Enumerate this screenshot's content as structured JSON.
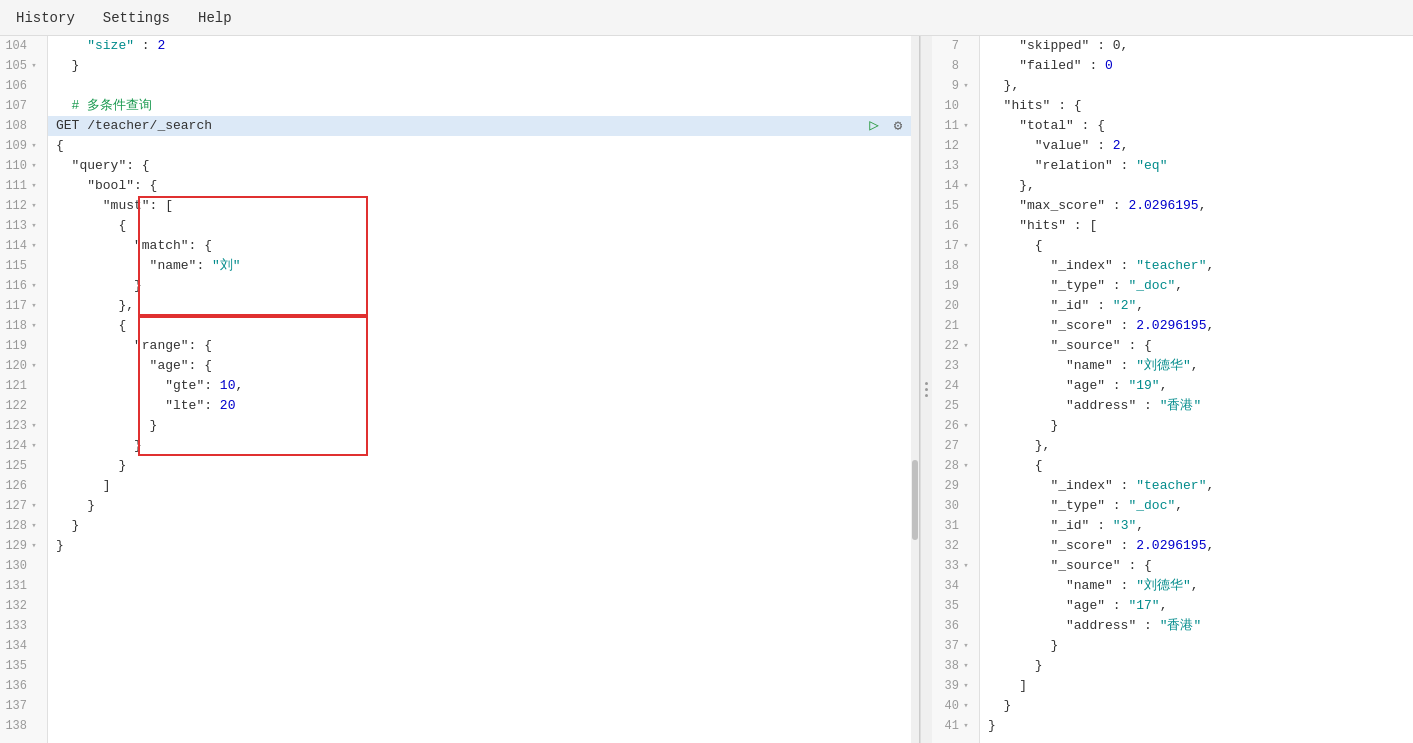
{
  "menu": {
    "items": [
      "History",
      "Settings",
      "Help"
    ]
  },
  "left_panel": {
    "lines": [
      {
        "num": 104,
        "fold": false,
        "content": [
          {
            "text": "    ",
            "class": ""
          },
          {
            "text": "\"size\"",
            "class": "c-teal"
          },
          {
            "text": " : ",
            "class": "c-dark"
          },
          {
            "text": "2",
            "class": "c-blue"
          }
        ]
      },
      {
        "num": 105,
        "fold": true,
        "content": [
          {
            "text": "  }",
            "class": "c-dark"
          }
        ]
      },
      {
        "num": 106,
        "fold": false,
        "content": []
      },
      {
        "num": 107,
        "fold": false,
        "content": [
          {
            "text": "  # 多条件查询",
            "class": "c-green"
          }
        ]
      },
      {
        "num": 108,
        "fold": false,
        "content": [
          {
            "text": "GET /teacher/_search",
            "class": "c-dark"
          }
        ],
        "highlighted": true,
        "toolbar": true
      },
      {
        "num": 109,
        "fold": true,
        "content": [
          {
            "text": "{",
            "class": "c-dark"
          }
        ]
      },
      {
        "num": 110,
        "fold": true,
        "content": [
          {
            "text": "  \"query\": {",
            "class": "c-dark"
          }
        ]
      },
      {
        "num": 111,
        "fold": true,
        "content": [
          {
            "text": "    \"bool\": {",
            "class": "c-dark"
          }
        ]
      },
      {
        "num": 112,
        "fold": true,
        "content": [
          {
            "text": "      \"must\": [",
            "class": "c-dark"
          }
        ]
      },
      {
        "num": 113,
        "fold": true,
        "content": [
          {
            "text": "        {",
            "class": "c-dark"
          }
        ]
      },
      {
        "num": 114,
        "fold": true,
        "content": [
          {
            "text": "          \"match\": {",
            "class": "c-dark"
          }
        ]
      },
      {
        "num": 115,
        "fold": false,
        "content": [
          {
            "text": "            \"name\": ",
            "class": "c-dark"
          },
          {
            "text": "\"刘\"",
            "class": "c-teal"
          }
        ]
      },
      {
        "num": 116,
        "fold": true,
        "content": [
          {
            "text": "          }",
            "class": "c-dark"
          }
        ]
      },
      {
        "num": 117,
        "fold": true,
        "content": [
          {
            "text": "        },",
            "class": "c-dark"
          }
        ]
      },
      {
        "num": 118,
        "fold": true,
        "content": [
          {
            "text": "        {",
            "class": "c-dark"
          }
        ]
      },
      {
        "num": 119,
        "fold": false,
        "content": [
          {
            "text": "          \"range\": {",
            "class": "c-dark"
          }
        ]
      },
      {
        "num": 120,
        "fold": true,
        "content": [
          {
            "text": "            \"age\": {",
            "class": "c-dark"
          }
        ]
      },
      {
        "num": 121,
        "fold": false,
        "content": [
          {
            "text": "              \"gte\": ",
            "class": "c-dark"
          },
          {
            "text": "10",
            "class": "c-blue"
          },
          {
            "text": ",",
            "class": "c-dark"
          }
        ]
      },
      {
        "num": 122,
        "fold": false,
        "content": [
          {
            "text": "              \"lte\": ",
            "class": "c-dark"
          },
          {
            "text": "20",
            "class": "c-blue"
          }
        ]
      },
      {
        "num": 123,
        "fold": true,
        "content": [
          {
            "text": "            }",
            "class": "c-dark"
          }
        ]
      },
      {
        "num": 124,
        "fold": true,
        "content": [
          {
            "text": "          }",
            "class": "c-dark"
          }
        ]
      },
      {
        "num": 125,
        "fold": false,
        "content": [
          {
            "text": "        }",
            "class": "c-dark"
          }
        ]
      },
      {
        "num": 126,
        "fold": false,
        "content": [
          {
            "text": "      ]",
            "class": "c-dark"
          }
        ]
      },
      {
        "num": 127,
        "fold": true,
        "content": [
          {
            "text": "    }",
            "class": "c-dark"
          }
        ]
      },
      {
        "num": 128,
        "fold": true,
        "content": [
          {
            "text": "  }",
            "class": "c-dark"
          }
        ]
      },
      {
        "num": 129,
        "fold": true,
        "content": [
          {
            "text": "}",
            "class": "c-dark"
          }
        ]
      },
      {
        "num": 130,
        "fold": false,
        "content": []
      },
      {
        "num": 131,
        "fold": false,
        "content": []
      },
      {
        "num": 132,
        "fold": false,
        "content": []
      },
      {
        "num": 133,
        "fold": false,
        "content": []
      },
      {
        "num": 134,
        "fold": false,
        "content": []
      },
      {
        "num": 135,
        "fold": false,
        "content": []
      },
      {
        "num": 136,
        "fold": false,
        "content": []
      },
      {
        "num": 137,
        "fold": false,
        "content": []
      },
      {
        "num": 138,
        "fold": false,
        "content": []
      }
    ]
  },
  "right_panel": {
    "lines": [
      {
        "num": 7,
        "fold": false,
        "content": [
          {
            "text": "    \"skipped\" : 0,",
            "class": "c-dark"
          }
        ]
      },
      {
        "num": 8,
        "fold": false,
        "content": [
          {
            "text": "    \"failed\" : ",
            "class": "c-dark"
          },
          {
            "text": "0",
            "class": "c-blue"
          }
        ]
      },
      {
        "num": 9,
        "fold": true,
        "content": [
          {
            "text": "  },",
            "class": "c-dark"
          }
        ]
      },
      {
        "num": 10,
        "fold": false,
        "content": [
          {
            "text": "  \"hits\" : {",
            "class": "c-dark"
          }
        ]
      },
      {
        "num": 11,
        "fold": true,
        "content": [
          {
            "text": "    \"total\" : {",
            "class": "c-dark"
          }
        ]
      },
      {
        "num": 12,
        "fold": false,
        "content": [
          {
            "text": "      \"value\" : ",
            "class": "c-dark"
          },
          {
            "text": "2",
            "class": "c-blue"
          },
          {
            "text": ",",
            "class": "c-dark"
          }
        ]
      },
      {
        "num": 13,
        "fold": false,
        "content": [
          {
            "text": "      \"relation\" : ",
            "class": "c-dark"
          },
          {
            "text": "\"eq\"",
            "class": "c-teal"
          }
        ]
      },
      {
        "num": 14,
        "fold": true,
        "content": [
          {
            "text": "    },",
            "class": "c-dark"
          }
        ]
      },
      {
        "num": 15,
        "fold": false,
        "content": [
          {
            "text": "    \"max_score\" : ",
            "class": "c-dark"
          },
          {
            "text": "2.0296195",
            "class": "c-blue"
          },
          {
            "text": ",",
            "class": "c-dark"
          }
        ]
      },
      {
        "num": 16,
        "fold": false,
        "content": [
          {
            "text": "    \"hits\" : [",
            "class": "c-dark"
          }
        ]
      },
      {
        "num": 17,
        "fold": true,
        "content": [
          {
            "text": "      {",
            "class": "c-dark"
          }
        ]
      },
      {
        "num": 18,
        "fold": false,
        "content": [
          {
            "text": "        \"_index\" : ",
            "class": "c-dark"
          },
          {
            "text": "\"teacher\"",
            "class": "c-teal"
          },
          {
            "text": ",",
            "class": "c-dark"
          }
        ]
      },
      {
        "num": 19,
        "fold": false,
        "content": [
          {
            "text": "        \"_type\" : ",
            "class": "c-dark"
          },
          {
            "text": "\"_doc\"",
            "class": "c-teal"
          },
          {
            "text": ",",
            "class": "c-dark"
          }
        ]
      },
      {
        "num": 20,
        "fold": false,
        "content": [
          {
            "text": "        \"_id\" : ",
            "class": "c-dark"
          },
          {
            "text": "\"2\"",
            "class": "c-teal"
          },
          {
            "text": ",",
            "class": "c-dark"
          }
        ]
      },
      {
        "num": 21,
        "fold": false,
        "content": [
          {
            "text": "        \"_score\" : ",
            "class": "c-dark"
          },
          {
            "text": "2.0296195",
            "class": "c-blue"
          },
          {
            "text": ",",
            "class": "c-dark"
          }
        ]
      },
      {
        "num": 22,
        "fold": true,
        "content": [
          {
            "text": "        \"_source\" : {",
            "class": "c-dark"
          }
        ]
      },
      {
        "num": 23,
        "fold": false,
        "content": [
          {
            "text": "          \"name\" : ",
            "class": "c-dark"
          },
          {
            "text": "\"刘德华\"",
            "class": "c-teal"
          },
          {
            "text": ",",
            "class": "c-dark"
          }
        ]
      },
      {
        "num": 24,
        "fold": false,
        "content": [
          {
            "text": "          \"age\" : ",
            "class": "c-dark"
          },
          {
            "text": "\"19\"",
            "class": "c-teal"
          },
          {
            "text": ",",
            "class": "c-dark"
          }
        ]
      },
      {
        "num": 25,
        "fold": false,
        "content": [
          {
            "text": "          \"address\" : ",
            "class": "c-dark"
          },
          {
            "text": "\"香港\"",
            "class": "c-teal"
          }
        ]
      },
      {
        "num": 26,
        "fold": true,
        "content": [
          {
            "text": "        }",
            "class": "c-dark"
          }
        ]
      },
      {
        "num": 27,
        "fold": false,
        "content": [
          {
            "text": "      },",
            "class": "c-dark"
          }
        ]
      },
      {
        "num": 28,
        "fold": true,
        "content": [
          {
            "text": "      {",
            "class": "c-dark"
          }
        ]
      },
      {
        "num": 29,
        "fold": false,
        "content": [
          {
            "text": "        \"_index\" : ",
            "class": "c-dark"
          },
          {
            "text": "\"teacher\"",
            "class": "c-teal"
          },
          {
            "text": ",",
            "class": "c-dark"
          }
        ]
      },
      {
        "num": 30,
        "fold": false,
        "content": [
          {
            "text": "        \"_type\" : ",
            "class": "c-dark"
          },
          {
            "text": "\"_doc\"",
            "class": "c-teal"
          },
          {
            "text": ",",
            "class": "c-dark"
          }
        ]
      },
      {
        "num": 31,
        "fold": false,
        "content": [
          {
            "text": "        \"_id\" : ",
            "class": "c-dark"
          },
          {
            "text": "\"3\"",
            "class": "c-teal"
          },
          {
            "text": ",",
            "class": "c-dark"
          }
        ]
      },
      {
        "num": 32,
        "fold": false,
        "content": [
          {
            "text": "        \"_score\" : ",
            "class": "c-dark"
          },
          {
            "text": "2.0296195",
            "class": "c-blue"
          },
          {
            "text": ",",
            "class": "c-dark"
          }
        ]
      },
      {
        "num": 33,
        "fold": true,
        "content": [
          {
            "text": "        \"_source\" : {",
            "class": "c-dark"
          }
        ]
      },
      {
        "num": 34,
        "fold": false,
        "content": [
          {
            "text": "          \"name\" : ",
            "class": "c-dark"
          },
          {
            "text": "\"刘德华\"",
            "class": "c-teal"
          },
          {
            "text": ",",
            "class": "c-dark"
          }
        ]
      },
      {
        "num": 35,
        "fold": false,
        "content": [
          {
            "text": "          \"age\" : ",
            "class": "c-dark"
          },
          {
            "text": "\"17\"",
            "class": "c-teal"
          },
          {
            "text": ",",
            "class": "c-dark"
          }
        ]
      },
      {
        "num": 36,
        "fold": false,
        "content": [
          {
            "text": "          \"address\" : ",
            "class": "c-dark"
          },
          {
            "text": "\"香港\"",
            "class": "c-teal"
          }
        ]
      },
      {
        "num": 37,
        "fold": true,
        "content": [
          {
            "text": "        }",
            "class": "c-dark"
          }
        ]
      },
      {
        "num": 38,
        "fold": true,
        "content": [
          {
            "text": "      }",
            "class": "c-dark"
          }
        ]
      },
      {
        "num": 39,
        "fold": true,
        "content": [
          {
            "text": "    ]",
            "class": "c-dark"
          }
        ]
      },
      {
        "num": 40,
        "fold": true,
        "content": [
          {
            "text": "  }",
            "class": "c-dark"
          }
        ]
      },
      {
        "num": 41,
        "fold": true,
        "content": [
          {
            "text": "}",
            "class": "c-dark"
          }
        ]
      }
    ]
  },
  "icons": {
    "play": "▷",
    "search": "🔍",
    "fold_open": "▾",
    "fold_closed": "▸"
  }
}
